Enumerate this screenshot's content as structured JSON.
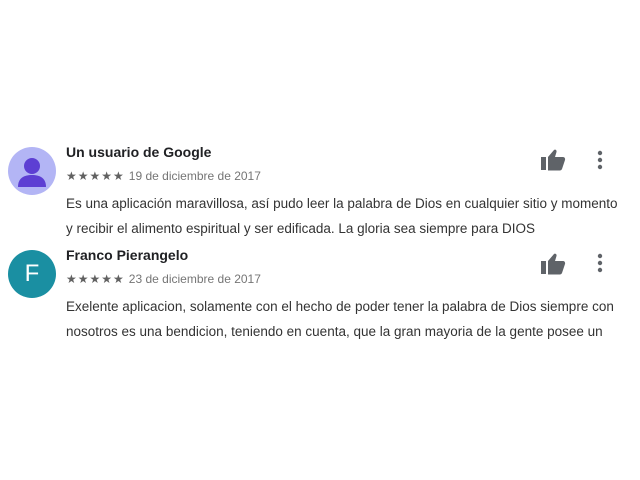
{
  "reviews": [
    {
      "author": "Un usuario de Google",
      "avatar": {
        "type": "anonymous",
        "color": "#b3b5f5",
        "figure_color": "#5d3fd3"
      },
      "rating": 5,
      "stars_text": "★★★★★",
      "date": "19 de diciembre de 2017",
      "text_line1": "Es una aplicación maravillosa, así pudo leer la palabra de Dios en cualquier sitio y momento",
      "text_line2": "y recibir el alimento espiritual y ser edificada. La gloria sea siempre para DIOS",
      "like_icon": "thumb-up-icon",
      "menu_icon": "more-vert-icon"
    },
    {
      "author": "Franco Pierangelo",
      "avatar": {
        "type": "letter",
        "letter": "F",
        "color": "#1a8fa2"
      },
      "rating": 5,
      "stars_text": "★★★★★",
      "date": "23 de diciembre de 2017",
      "text_line1": "Exelente aplicacion, solamente con el hecho de poder tener la palabra de Dios siempre con",
      "text_line2": "nosotros es una bendicion, teniendo en cuenta, que la gran mayoria de la gente posee un",
      "like_icon": "thumb-up-icon",
      "menu_icon": "more-vert-icon"
    }
  ]
}
